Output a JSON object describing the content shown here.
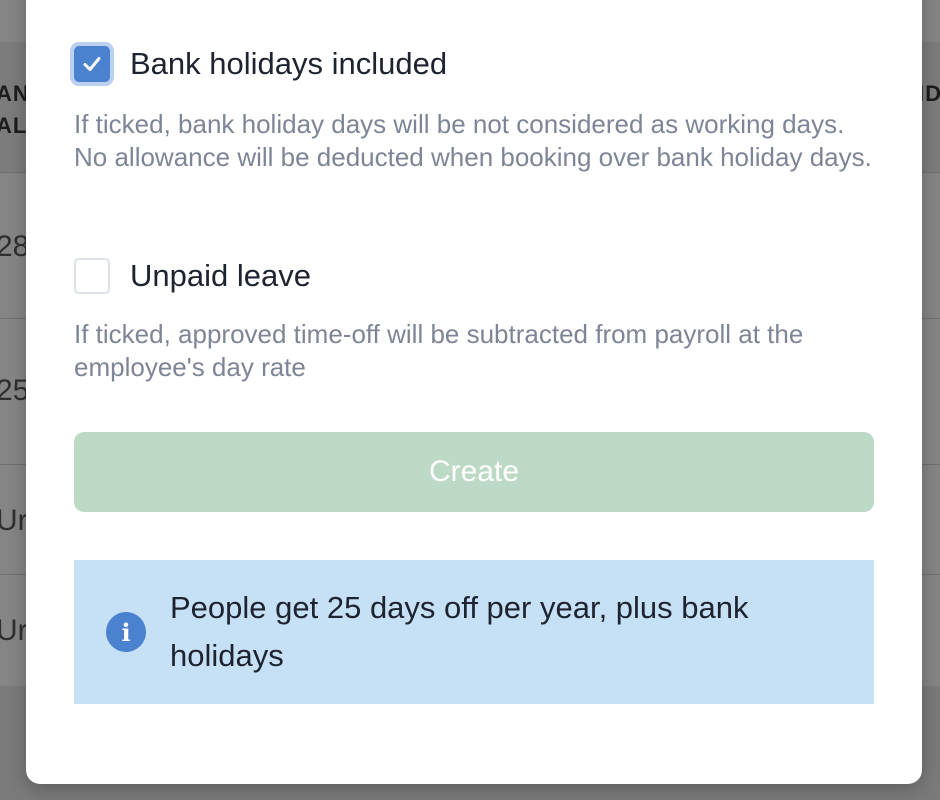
{
  "background": {
    "column_header_left": [
      "AN",
      "AL"
    ],
    "column_header_right": "ID",
    "row_values": [
      "28",
      "25",
      "Ur",
      "Ur"
    ]
  },
  "modal": {
    "bank_holidays": {
      "label": "Bank holidays included",
      "checked": true,
      "help": "If ticked, bank holiday days will be not considered as working days. No allowance will be deducted when booking over bank holiday days."
    },
    "unpaid_leave": {
      "label": "Unpaid leave",
      "checked": false,
      "help": "If ticked, approved time-off will be subtracted from payroll at the employee's day rate"
    },
    "create_button": {
      "label": "Create",
      "state": "disabled"
    },
    "info": {
      "icon": "info-icon",
      "text": "People get 25 days off per year, plus bank holidays"
    }
  },
  "colors": {
    "accent": "#4a82cf",
    "create_button_disabled": "#bcdac5",
    "info_background": "#c6e0f5",
    "help_text": "#7d8596"
  }
}
